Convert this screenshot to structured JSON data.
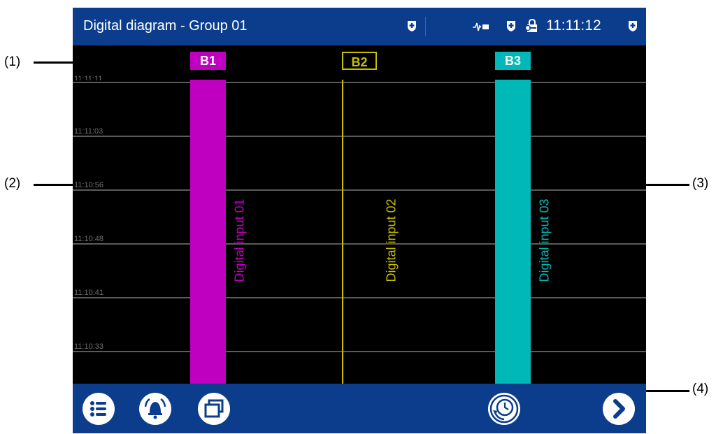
{
  "callouts": {
    "c1": "(1)",
    "c2": "(2)",
    "c3": "(3)",
    "c4": "(4)"
  },
  "titlebar": {
    "title": "Digital diagram - Group 01",
    "time": "11:11:12"
  },
  "time_axis": [
    "11:11:11",
    "11:11:03",
    "11:10:56",
    "11:10:48",
    "11:10:41",
    "11:10:33"
  ],
  "channels": [
    {
      "badge": "B1",
      "label": "Digital input 01",
      "color": "#c000c0",
      "state": "on"
    },
    {
      "badge": "B2",
      "label": "Digital input 02",
      "color": "#c8c000",
      "state": "off"
    },
    {
      "badge": "B3",
      "label": "Digital input 03",
      "color": "#00b8b8",
      "state": "on"
    }
  ],
  "icons": {
    "menu": "menu-list-icon",
    "alarm": "alarm-bell-icon",
    "windows": "windows-icon",
    "history": "history-clock-icon",
    "next": "next-arrow-icon",
    "status": [
      "shield-plus-icon",
      "signal-icon",
      "shield-plus-icon",
      "lock-key-icon",
      "shield-plus-icon"
    ]
  },
  "colors": {
    "bar": "#0b3d8c",
    "grid": "#5a5a5a",
    "background": "#000000"
  }
}
